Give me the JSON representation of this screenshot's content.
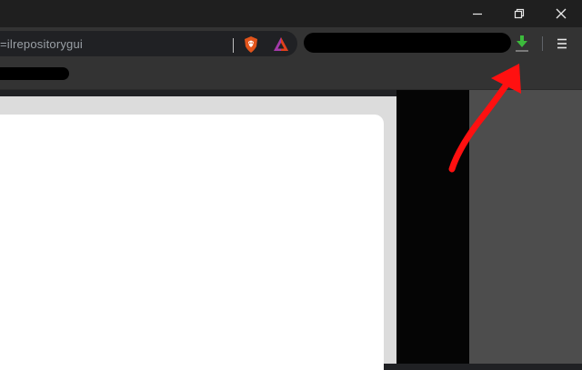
{
  "browser": {
    "address_bar": {
      "url_fragment": "=ilrepositorygui"
    },
    "icons": {
      "shield": "brave-shield-icon",
      "rewards": "brave-rewards-icon",
      "download": "download-icon",
      "menu": "hamburger-menu-icon"
    },
    "window_controls": {
      "minimize": "─",
      "restore": "❐",
      "close": "✕"
    }
  },
  "colors": {
    "titlebar": "#1f1f1f",
    "toolbar": "#333333",
    "omnibox": "#202124",
    "download_green": "#3cba3c",
    "annotation_red": "#ff1010",
    "side_panel": "#4d4d4d"
  }
}
